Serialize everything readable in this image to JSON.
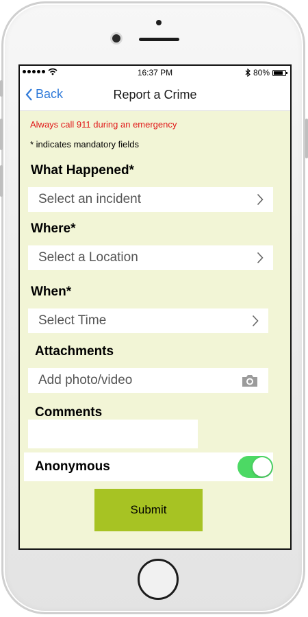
{
  "status_bar": {
    "time": "16:37 PM",
    "battery_percent": "80%",
    "battery_level": 0.8,
    "icons": [
      "signal-dots-icon",
      "wifi-icon",
      "bluetooth-icon",
      "battery-icon"
    ]
  },
  "nav": {
    "back_label": "Back",
    "title": "Report a Crime",
    "accent_color": "#2f7ad9"
  },
  "form": {
    "warning": "Always call 911 during an emergency",
    "warning_color": "#e01818",
    "mandatory_note": "* indicates mandatory fields",
    "what_happened": {
      "label": "What Happened*",
      "placeholder": "Select an incident"
    },
    "where": {
      "label": "Where*",
      "placeholder": "Select a Location"
    },
    "when": {
      "label": "When*",
      "placeholder": "Select Time"
    },
    "attachments": {
      "label": "Attachments",
      "placeholder": "Add photo/video",
      "icon": "camera-icon"
    },
    "comments": {
      "label": "Comments",
      "value": ""
    },
    "anonymous": {
      "label": "Anonymous",
      "enabled": true,
      "toggle_color": "#4cd964"
    },
    "submit_label": "Submit",
    "submit_color": "#a7c323",
    "background_color": "#f2f5d6"
  }
}
